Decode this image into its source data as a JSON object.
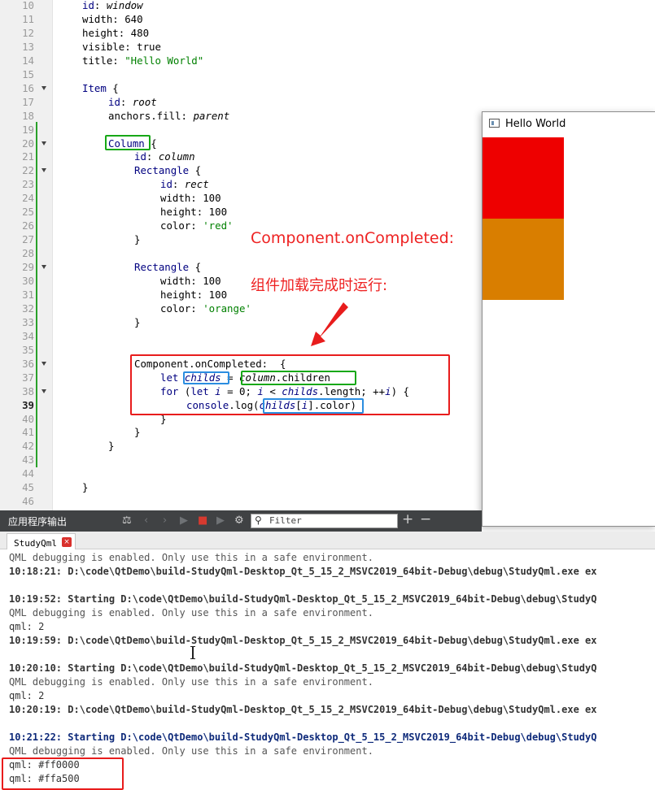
{
  "editor": {
    "lines": [
      {
        "n": "10",
        "indent": 0,
        "fold": false,
        "html": "<span class=\"kw\">id</span>: <span class=\"it\">window</span>"
      },
      {
        "n": "11",
        "indent": 0,
        "fold": false,
        "html": "width: 640"
      },
      {
        "n": "12",
        "indent": 0,
        "fold": false,
        "html": "height: 480"
      },
      {
        "n": "13",
        "indent": 0,
        "fold": false,
        "html": "visible: true"
      },
      {
        "n": "14",
        "indent": 0,
        "fold": false,
        "html": "title: <span class=\"str\">\"Hello World\"</span>"
      },
      {
        "n": "15",
        "indent": 0,
        "fold": false,
        "html": ""
      },
      {
        "n": "16",
        "indent": 0,
        "fold": true,
        "html": "<span class=\"kw\">Item</span> {"
      },
      {
        "n": "17",
        "indent": 1,
        "fold": false,
        "html": "<span class=\"kw\">id</span>: <span class=\"it\">root</span>"
      },
      {
        "n": "18",
        "indent": 1,
        "fold": false,
        "html": "anchors.fill: <span class=\"it\">parent</span>"
      },
      {
        "n": "19",
        "indent": 0,
        "fold": false,
        "html": ""
      },
      {
        "n": "20",
        "indent": 1,
        "fold": true,
        "html": "<span class=\"kw\">Column</span> {"
      },
      {
        "n": "21",
        "indent": 2,
        "fold": false,
        "html": "<span class=\"kw\">id</span>: <span class=\"it\">column</span>"
      },
      {
        "n": "22",
        "indent": 2,
        "fold": true,
        "html": "<span class=\"kw\">Rectangle</span> {"
      },
      {
        "n": "23",
        "indent": 3,
        "fold": false,
        "html": "<span class=\"kw\">id</span>: <span class=\"it\">rect</span>"
      },
      {
        "n": "24",
        "indent": 3,
        "fold": false,
        "html": "width: 100"
      },
      {
        "n": "25",
        "indent": 3,
        "fold": false,
        "html": "height: 100"
      },
      {
        "n": "26",
        "indent": 3,
        "fold": false,
        "html": "color: <span class=\"str\">'red'</span>"
      },
      {
        "n": "27",
        "indent": 2,
        "fold": false,
        "html": "}"
      },
      {
        "n": "28",
        "indent": 0,
        "fold": false,
        "html": ""
      },
      {
        "n": "29",
        "indent": 2,
        "fold": true,
        "html": "<span class=\"kw\">Rectangle</span> {"
      },
      {
        "n": "30",
        "indent": 3,
        "fold": false,
        "html": "width: 100"
      },
      {
        "n": "31",
        "indent": 3,
        "fold": false,
        "html": "height: 100"
      },
      {
        "n": "32",
        "indent": 3,
        "fold": false,
        "html": "color: <span class=\"str\">'orange'</span>"
      },
      {
        "n": "33",
        "indent": 2,
        "fold": false,
        "html": "}"
      },
      {
        "n": "34",
        "indent": 0,
        "fold": false,
        "html": ""
      },
      {
        "n": "35",
        "indent": 0,
        "fold": false,
        "html": ""
      },
      {
        "n": "36",
        "indent": 2,
        "fold": true,
        "html": "Component.onCompleted:  {"
      },
      {
        "n": "37",
        "indent": 3,
        "fold": false,
        "html": "<span class=\"kw\">let</span> <span class=\"var\">childs</span> = <span class=\"it\">column</span>.children"
      },
      {
        "n": "38",
        "indent": 3,
        "fold": true,
        "html": "<span class=\"kw\">for</span> (<span class=\"kw\">let</span> <span class=\"var\">i</span> = 0; <span class=\"var\">i</span> &lt; <span class=\"var\">childs</span>.length; ++<span class=\"var\">i</span>) {"
      },
      {
        "n": "39",
        "indent": 4,
        "fold": false,
        "current": true,
        "html": "<span class=\"kw\">console</span>.log(<span class=\"var\">childs</span>[<span class=\"var\">i</span>].color)"
      },
      {
        "n": "40",
        "indent": 3,
        "fold": false,
        "html": "}"
      },
      {
        "n": "41",
        "indent": 2,
        "fold": false,
        "html": "}"
      },
      {
        "n": "42",
        "indent": 1,
        "fold": false,
        "html": "}"
      },
      {
        "n": "43",
        "indent": 0,
        "fold": false,
        "html": ""
      },
      {
        "n": "44",
        "indent": 0,
        "fold": false,
        "html": ""
      },
      {
        "n": "45",
        "indent": 0,
        "fold": false,
        "html": "}"
      },
      {
        "n": "46",
        "indent": 0,
        "fold": false,
        "html": ""
      }
    ]
  },
  "annotations": {
    "line1": "Component.onCompleted:",
    "line2": "组件加载完成时运行:"
  },
  "preview": {
    "title": "Hello World",
    "rect1_color": "#ee0000",
    "rect2_color": "#d97e00"
  },
  "output_pane": {
    "title": "应用程序输出",
    "filter_placeholder": "Filter",
    "tab_label": "StudyQml",
    "tab_close": "×"
  },
  "log": [
    {
      "style": "grey",
      "text": "QML debugging is enabled. Only use this in a safe environment."
    },
    {
      "style": "dark",
      "text": "10:18:21: D:\\code\\QtDemo\\build-StudyQml-Desktop_Qt_5_15_2_MSVC2019_64bit-Debug\\debug\\StudyQml.exe ex"
    },
    {
      "style": "plain",
      "text": ""
    },
    {
      "style": "dark",
      "text": "10:19:52: Starting D:\\code\\QtDemo\\build-StudyQml-Desktop_Qt_5_15_2_MSVC2019_64bit-Debug\\debug\\StudyQ"
    },
    {
      "style": "grey",
      "text": "QML debugging is enabled. Only use this in a safe environment."
    },
    {
      "style": "plain",
      "text": "qml: 2"
    },
    {
      "style": "dark",
      "text": "10:19:59: D:\\code\\QtDemo\\build-StudyQml-Desktop_Qt_5_15_2_MSVC2019_64bit-Debug\\debug\\StudyQml.exe ex"
    },
    {
      "style": "plain",
      "text": ""
    },
    {
      "style": "dark",
      "text": "10:20:10: Starting D:\\code\\QtDemo\\build-StudyQml-Desktop_Qt_5_15_2_MSVC2019_64bit-Debug\\debug\\StudyQ"
    },
    {
      "style": "grey",
      "text": "QML debugging is enabled. Only use this in a safe environment."
    },
    {
      "style": "plain",
      "text": "qml: 2"
    },
    {
      "style": "dark",
      "text": "10:20:19: D:\\code\\QtDemo\\build-StudyQml-Desktop_Qt_5_15_2_MSVC2019_64bit-Debug\\debug\\StudyQml.exe ex"
    },
    {
      "style": "plain",
      "text": ""
    },
    {
      "style": "navy",
      "text": "10:21:22: Starting D:\\code\\QtDemo\\build-StudyQml-Desktop_Qt_5_15_2_MSVC2019_64bit-Debug\\debug\\StudyQ"
    },
    {
      "style": "grey",
      "text": "QML debugging is enabled. Only use this in a safe environment."
    },
    {
      "style": "plain",
      "text": "qml: #ff0000"
    },
    {
      "style": "plain",
      "text": "qml: #ffa500"
    }
  ]
}
